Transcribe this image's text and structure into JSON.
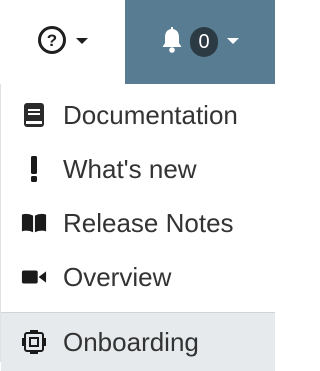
{
  "header": {
    "help_icon": "question-circle-icon",
    "help_caret_icon": "caret-down-icon",
    "notifications_icon": "bell-icon",
    "notifications_count": "0",
    "notifications_caret_icon": "caret-down-icon",
    "notifications_bg": "#587c92"
  },
  "menu": {
    "items": [
      {
        "label": "Documentation",
        "icon": "book-icon"
      },
      {
        "label": "What's new",
        "icon": "exclamation-icon"
      },
      {
        "label": "Release Notes",
        "icon": "open-book-icon"
      },
      {
        "label": "Overview",
        "icon": "video-camera-icon"
      }
    ],
    "footer_item": {
      "label": "Onboarding",
      "icon": "onboarding-icon"
    }
  }
}
